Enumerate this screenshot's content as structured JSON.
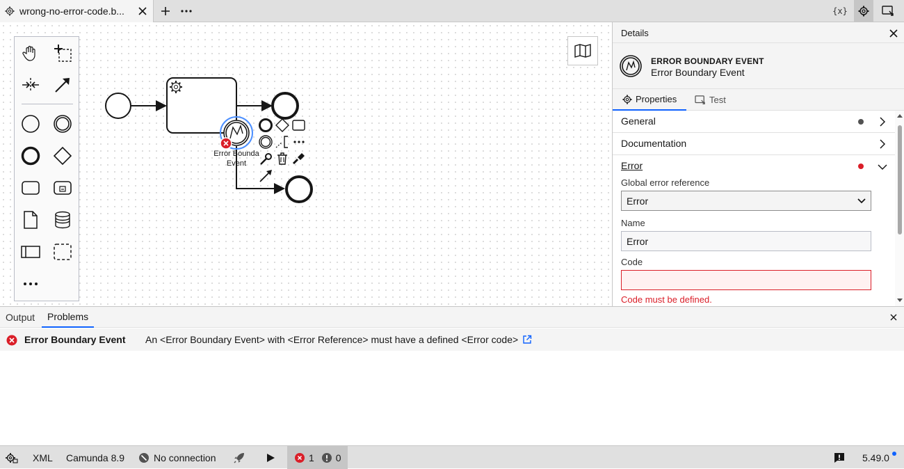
{
  "tab": {
    "title": "wrong-no-error-code.b..."
  },
  "toolbar": {
    "variables_label": "{x}"
  },
  "diagram": {
    "boundary_event_label_1": "Error Bounda",
    "boundary_event_label_2": "Event"
  },
  "details": {
    "header": "Details",
    "element_type": "ERROR BOUNDARY EVENT",
    "element_name": "Error Boundary Event",
    "tabs": [
      "Properties",
      "Test"
    ],
    "groups": {
      "general": "General",
      "documentation": "Documentation",
      "error": "Error"
    },
    "fields": {
      "global_error_reference_label": "Global error reference",
      "global_error_reference_value": "Error",
      "name_label": "Name",
      "name_value": "Error",
      "code_label": "Code",
      "code_value": "",
      "code_error": "Code must be defined."
    },
    "colors": {
      "error": "#da1e28",
      "accent": "#0f62fe",
      "dot": "#525252"
    }
  },
  "bottom": {
    "tabs": [
      "Output",
      "Problems"
    ],
    "problem": {
      "element": "Error Boundary Event",
      "message": "An <Error Boundary Event> with <Error Reference> must have a defined <Error code>"
    }
  },
  "status": {
    "format": "XML",
    "engine": "Camunda 8.9",
    "connection": "No connection",
    "errors": "1",
    "warnings": "0",
    "version": "5.49.0"
  }
}
